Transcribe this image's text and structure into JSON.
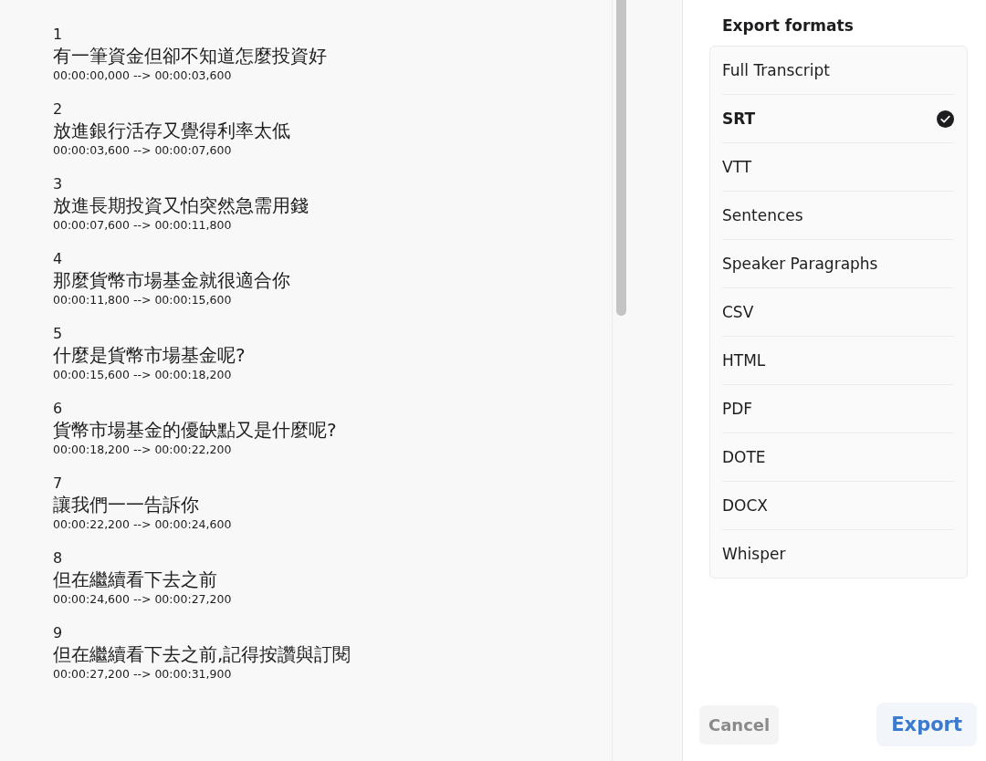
{
  "subtitles": [
    {
      "index": "1",
      "text": "有一筆資金但卻不知道怎麼投資好",
      "time": "00:00:00,000 --> 00:00:03,600"
    },
    {
      "index": "2",
      "text": "放進銀行活存又覺得利率太低",
      "time": "00:00:03,600 --> 00:00:07,600"
    },
    {
      "index": "3",
      "text": "放進長期投資又怕突然急需用錢",
      "time": "00:00:07,600 --> 00:00:11,800"
    },
    {
      "index": "4",
      "text": "那麼貨幣市場基金就很適合你",
      "time": "00:00:11,800 --> 00:00:15,600"
    },
    {
      "index": "5",
      "text": "什麼是貨幣市場基金呢?",
      "time": "00:00:15,600 --> 00:00:18,200"
    },
    {
      "index": "6",
      "text": "貨幣市場基金的優缺點又是什麼呢?",
      "time": "00:00:18,200 --> 00:00:22,200"
    },
    {
      "index": "7",
      "text": "讓我們一一告訴你",
      "time": "00:00:22,200 --> 00:00:24,600"
    },
    {
      "index": "8",
      "text": "但在繼續看下去之前",
      "time": "00:00:24,600 --> 00:00:27,200"
    },
    {
      "index": "9",
      "text": "但在繼續看下去之前,記得按讚與訂閱",
      "time": "00:00:27,200 --> 00:00:31,900"
    }
  ],
  "export_panel": {
    "title": "Export formats",
    "formats": [
      {
        "label": "Full Transcript",
        "selected": false
      },
      {
        "label": "SRT",
        "selected": true
      },
      {
        "label": "VTT",
        "selected": false
      },
      {
        "label": "Sentences",
        "selected": false
      },
      {
        "label": "Speaker Paragraphs",
        "selected": false
      },
      {
        "label": "CSV",
        "selected": false
      },
      {
        "label": "HTML",
        "selected": false
      },
      {
        "label": "PDF",
        "selected": false
      },
      {
        "label": "DOTE",
        "selected": false
      },
      {
        "label": "DOCX",
        "selected": false
      },
      {
        "label": "Whisper",
        "selected": false
      }
    ]
  },
  "buttons": {
    "cancel": "Cancel",
    "export": "Export"
  }
}
